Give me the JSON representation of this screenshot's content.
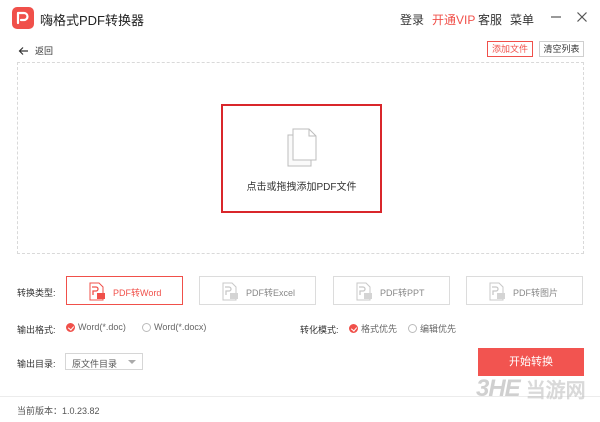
{
  "app": {
    "title": "嗨格式PDF转换器"
  },
  "topnav": {
    "login": "登录",
    "vip": "开通VIP",
    "service": "客服",
    "menu": "菜单"
  },
  "toolbar": {
    "back": "返回",
    "add_file": "添加文件",
    "clear_list": "清空列表"
  },
  "drop": {
    "hint": "点击或拖拽添加PDF文件"
  },
  "conversion": {
    "label": "转换类型:",
    "types": [
      {
        "label": "PDF转Word",
        "active": true
      },
      {
        "label": "PDF转Excel",
        "active": false
      },
      {
        "label": "PDF转PPT",
        "active": false
      },
      {
        "label": "PDF转图片",
        "active": false
      }
    ]
  },
  "output_format": {
    "label": "输出格式:",
    "options": [
      {
        "label": "Word(*.doc)",
        "selected": true
      },
      {
        "label": "Word(*.docx)",
        "selected": false
      }
    ]
  },
  "convert_mode": {
    "label": "转化模式:",
    "options": [
      {
        "label": "格式优先",
        "selected": true
      },
      {
        "label": "编辑优先",
        "selected": false
      }
    ]
  },
  "output_dir": {
    "label": "输出目录:",
    "value": "原文件目录"
  },
  "start_button": "开始转换",
  "footer": {
    "version": "当前版本：1.0.23.82"
  },
  "watermark": {
    "brand": "3HE",
    "site": "当游网"
  },
  "colors": {
    "accent": "#f0504a",
    "highlight": "#d9262b"
  }
}
